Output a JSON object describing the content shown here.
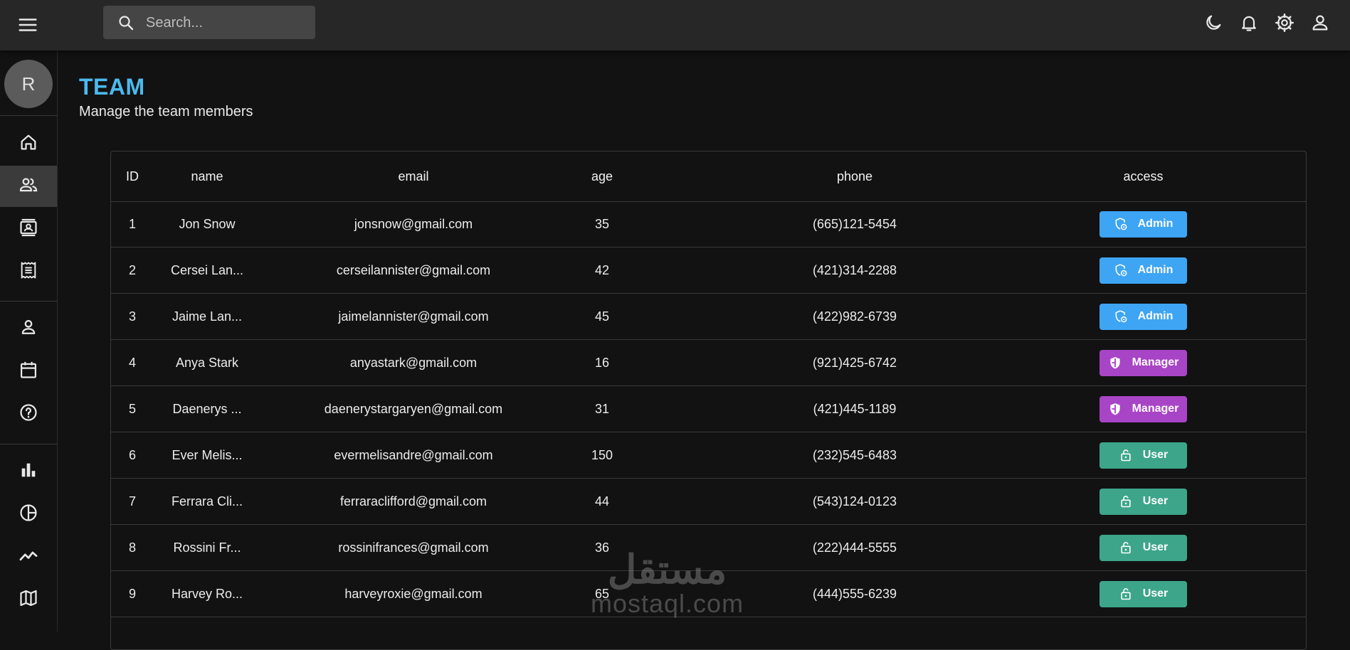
{
  "header": {
    "search_placeholder": "Search...",
    "icons": [
      "menu-icon",
      "search-icon",
      "dark-mode-icon",
      "notifications-icon",
      "settings-icon",
      "profile-icon"
    ]
  },
  "sidebar": {
    "avatar_letter": "R",
    "items": [
      {
        "name": "home",
        "icon": "home-icon",
        "active": false
      },
      {
        "name": "team",
        "icon": "team-icon",
        "active": true
      },
      {
        "name": "contacts",
        "icon": "contacts-icon",
        "active": false
      },
      {
        "name": "invoices",
        "icon": "invoices-icon",
        "active": false
      },
      {
        "name": "profile-form",
        "icon": "person-icon",
        "active": false
      },
      {
        "name": "calendar",
        "icon": "calendar-icon",
        "active": false
      },
      {
        "name": "faq",
        "icon": "help-icon",
        "active": false
      },
      {
        "name": "bar-chart",
        "icon": "bar-chart-icon",
        "active": false
      },
      {
        "name": "pie-chart",
        "icon": "pie-chart-icon",
        "active": false
      },
      {
        "name": "line-chart",
        "icon": "line-chart-icon",
        "active": false
      },
      {
        "name": "geography",
        "icon": "map-icon",
        "active": false
      }
    ]
  },
  "page": {
    "title": "TEAM",
    "subtitle": "Manage the team members"
  },
  "table": {
    "columns": [
      "ID",
      "name",
      "email",
      "age",
      "phone",
      "access"
    ],
    "rows": [
      {
        "id": "1",
        "name": "Jon Snow",
        "email": "jonsnow@gmail.com",
        "age": "35",
        "phone": "(665)121-5454",
        "access": "Admin"
      },
      {
        "id": "2",
        "name": "Cersei Lan...",
        "email": "cerseilannister@gmail.com",
        "age": "42",
        "phone": "(421)314-2288",
        "access": "Admin"
      },
      {
        "id": "3",
        "name": "Jaime Lan...",
        "email": "jaimelannister@gmail.com",
        "age": "45",
        "phone": "(422)982-6739",
        "access": "Admin"
      },
      {
        "id": "4",
        "name": "Anya Stark",
        "email": "anyastark@gmail.com",
        "age": "16",
        "phone": "(921)425-6742",
        "access": "Manager"
      },
      {
        "id": "5",
        "name": "Daenerys ...",
        "email": "daenerystargaryen@gmail.com",
        "age": "31",
        "phone": "(421)445-1189",
        "access": "Manager"
      },
      {
        "id": "6",
        "name": "Ever Melis...",
        "email": "evermelisandre@gmail.com",
        "age": "150",
        "phone": "(232)545-6483",
        "access": "User"
      },
      {
        "id": "7",
        "name": "Ferrara Cli...",
        "email": "ferraraclifford@gmail.com",
        "age": "44",
        "phone": "(543)124-0123",
        "access": "User"
      },
      {
        "id": "8",
        "name": "Rossini Fr...",
        "email": "rossinifrances@gmail.com",
        "age": "36",
        "phone": "(222)444-5555",
        "access": "User"
      },
      {
        "id": "9",
        "name": "Harvey Ro...",
        "email": "harveyroxie@gmail.com",
        "age": "65",
        "phone": "(444)555-6239",
        "access": "User"
      }
    ]
  },
  "access_styles": {
    "Admin": {
      "color": "#3da5f4",
      "icon": "admin-icon"
    },
    "Manager": {
      "color": "#a844c6",
      "icon": "security-icon"
    },
    "User": {
      "color": "#3da58a",
      "icon": "lock-open-icon"
    }
  },
  "colors": {
    "accent": "#4cb9ef",
    "background": "#121212",
    "topbar": "#272727"
  },
  "watermark": {
    "arabic": "مستقل",
    "latin": "mostaql.com"
  }
}
